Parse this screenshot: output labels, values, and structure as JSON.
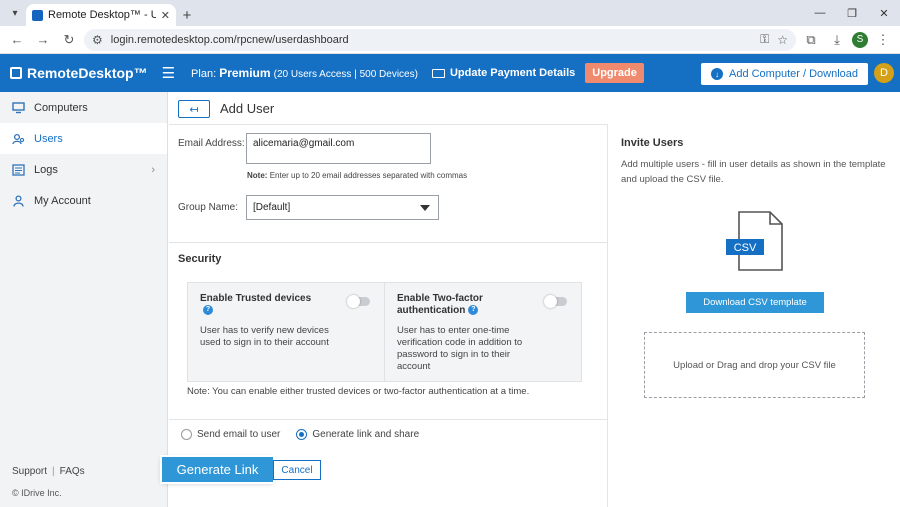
{
  "browser": {
    "tab_title": "Remote Desktop™ - User Mana",
    "url": "login.remotedesktop.com/rpcnew/userdashboard",
    "profile_initial": "S"
  },
  "header": {
    "logo": "RemoteDesktop™",
    "plan_label": "Plan:",
    "plan_name": "Premium",
    "plan_details": "(20 Users Access | 500 Devices)",
    "update_payment": "Update Payment Details",
    "upgrade": "Upgrade",
    "add_computer": "Add Computer / Download",
    "user_initial": "D"
  },
  "sidebar": {
    "items": [
      {
        "label": "Computers",
        "icon": "monitor-icon"
      },
      {
        "label": "Users",
        "icon": "users-icon"
      },
      {
        "label": "Logs",
        "icon": "logs-icon"
      },
      {
        "label": "My Account",
        "icon": "person-icon"
      }
    ],
    "support": "Support",
    "faqs": "FAQs",
    "copyright": "© IDrive Inc."
  },
  "main": {
    "title": "Add User",
    "email_label": "Email Address:",
    "email_value": "alicemaria@gmail.com",
    "note_bold": "Note:",
    "note_text": "Enter up to 20 email addresses separated with commas",
    "group_label": "Group Name:",
    "group_value": "[Default]",
    "security_title": "Security",
    "trusted_title": "Enable Trusted devices",
    "trusted_desc": "User has to verify new devices used to sign in to their account",
    "twofa_title": "Enable Two-factor authentication",
    "twofa_desc": "User has to enter one-time verification code in addition to password to sign in to their account",
    "security_note": "Note: You can enable either trusted devices or two-factor authentication at a time.",
    "radio_email": "Send email to user",
    "radio_link": "Generate link and share",
    "generate": "Generate Link",
    "cancel": "Cancel"
  },
  "invite": {
    "title": "Invite Users",
    "desc": "Add multiple users - fill in user details as shown in the template and upload the CSV file.",
    "csv_label": "CSV",
    "download": "Download CSV template",
    "dropzone": "Upload or Drag and drop your CSV file"
  },
  "colors": {
    "brand_blue": "#1570c4",
    "button_blue": "#2f97d8",
    "upgrade_orange": "#f08a6e"
  }
}
